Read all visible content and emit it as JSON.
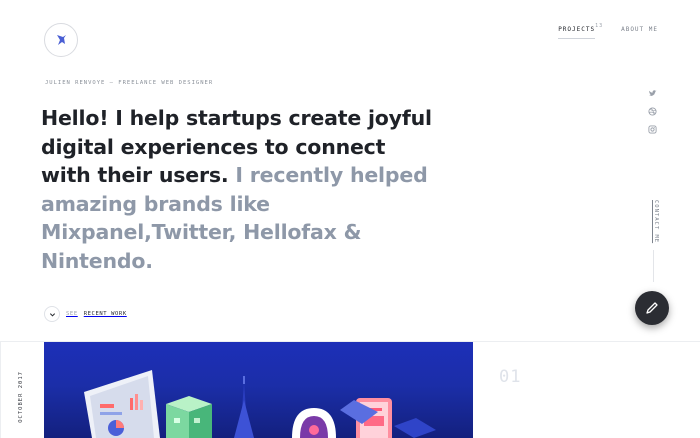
{
  "nav": {
    "projects_label": "PROJECTS",
    "projects_count": "13",
    "about_label": "ABOUT ME"
  },
  "hero": {
    "eyebrow": "JULIEN RENVOYE — FREELANCE WEB DESIGNER",
    "headline_main": "Hello! I help startups create joyful digital experiences to connect with their users. ",
    "headline_muted": "I recently helped amazing brands like Mixpanel,Twitter, Hellofax & Nintendo."
  },
  "cta": {
    "prefix": "SEE",
    "label": "RECENT WORK"
  },
  "sidebar": {
    "social_icons": [
      "twitter-icon",
      "dribbble-icon",
      "instagram-icon"
    ],
    "contact_label": "CONTACT ME"
  },
  "project": {
    "date": "OCTOBER 2017",
    "number": "01",
    "bg_color": "#1d2fb8"
  },
  "colors": {
    "accent_blue": "#1d2fb8",
    "muted_text": "#8e98a8",
    "fab_dark": "#2b2d33"
  }
}
